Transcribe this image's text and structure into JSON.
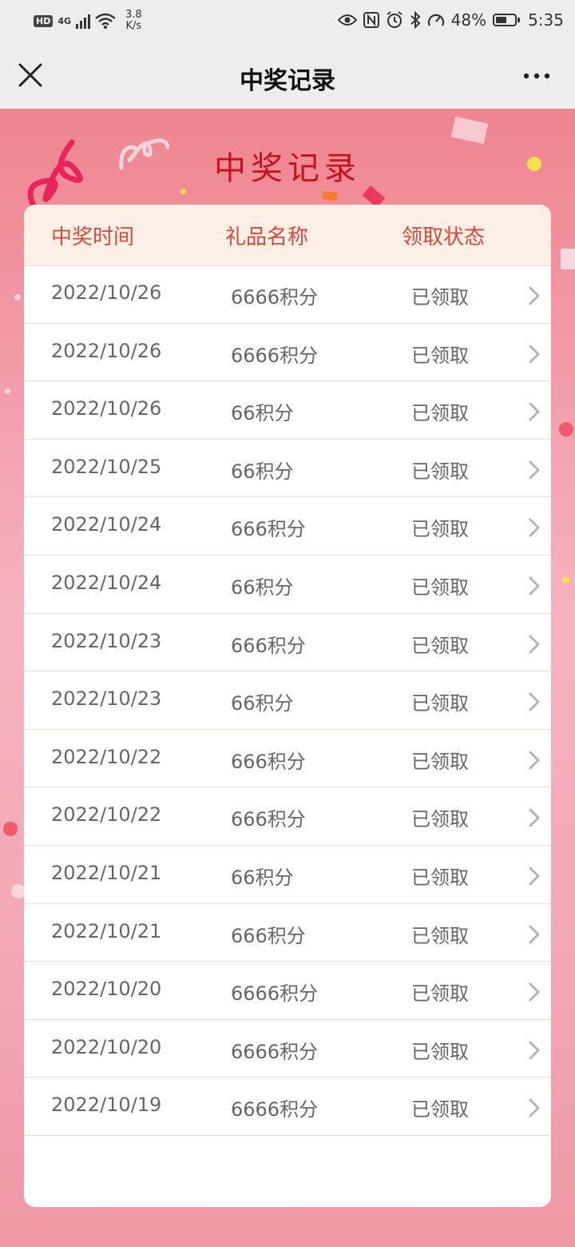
{
  "status_bar": {
    "hd": "HD",
    "network": "4G",
    "speed_value": "3.8",
    "speed_unit": "K/s",
    "battery": "48%",
    "time": "5:35"
  },
  "nav": {
    "title": "中奖记录"
  },
  "hero": {
    "title": "中奖记录"
  },
  "table": {
    "headers": [
      "中奖时间",
      "礼品名称",
      "领取状态"
    ],
    "rows": [
      {
        "date": "2022/10/26",
        "gift": "6666积分",
        "status": "已领取"
      },
      {
        "date": "2022/10/26",
        "gift": "6666积分",
        "status": "已领取"
      },
      {
        "date": "2022/10/26",
        "gift": "66积分",
        "status": "已领取"
      },
      {
        "date": "2022/10/25",
        "gift": "66积分",
        "status": "已领取"
      },
      {
        "date": "2022/10/24",
        "gift": "666积分",
        "status": "已领取"
      },
      {
        "date": "2022/10/24",
        "gift": "66积分",
        "status": "已领取"
      },
      {
        "date": "2022/10/23",
        "gift": "666积分",
        "status": "已领取"
      },
      {
        "date": "2022/10/23",
        "gift": "66积分",
        "status": "已领取"
      },
      {
        "date": "2022/10/22",
        "gift": "666积分",
        "status": "已领取"
      },
      {
        "date": "2022/10/22",
        "gift": "666积分",
        "status": "已领取"
      },
      {
        "date": "2022/10/21",
        "gift": "66积分",
        "status": "已领取"
      },
      {
        "date": "2022/10/21",
        "gift": "666积分",
        "status": "已领取"
      },
      {
        "date": "2022/10/20",
        "gift": "6666积分",
        "status": "已领取"
      },
      {
        "date": "2022/10/20",
        "gift": "6666积分",
        "status": "已领取"
      },
      {
        "date": "2022/10/19",
        "gift": "6666积分",
        "status": "已领取"
      }
    ]
  },
  "colors": {
    "accent": "#c4121e",
    "header_text": "#d44a3a",
    "row_text": "#6b6466"
  }
}
